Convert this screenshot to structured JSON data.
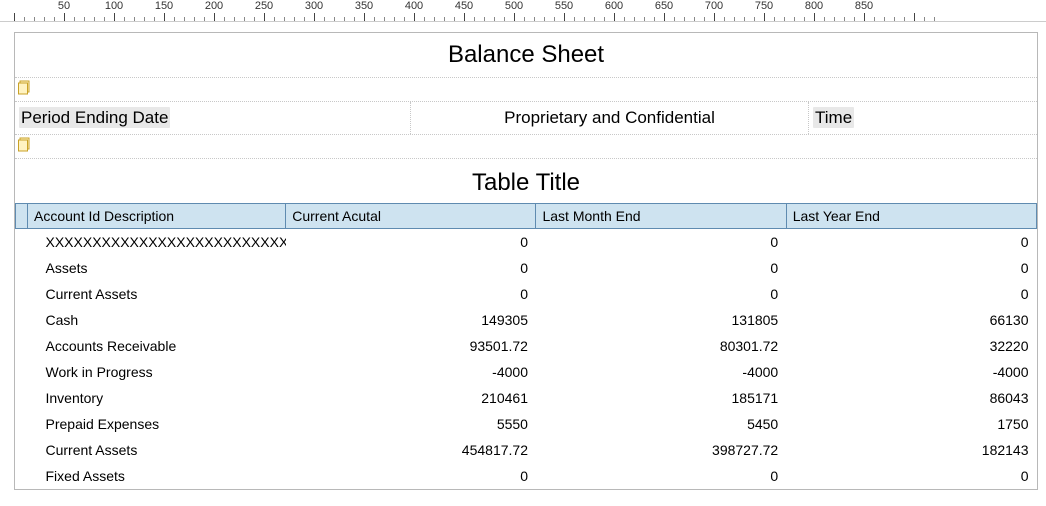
{
  "ruler": {
    "start": 50,
    "end": 870,
    "major": 50,
    "minor": 10
  },
  "report": {
    "title": "Balance Sheet",
    "header": {
      "period_label": "Period Ending Date",
      "confidential": "Proprietary and Confidential",
      "time_label": "Time"
    },
    "table_title": "Table Title",
    "columns": [
      "Account Id Description",
      "Current Acutal",
      "Last Month End",
      "Last Year End"
    ],
    "rows": [
      {
        "desc": "XXXXXXXXXXXXXXXXXXXXXXXXXXXXXXX",
        "c1": "0",
        "c2": "0",
        "c3": "0"
      },
      {
        "desc": "Assets",
        "c1": "0",
        "c2": "0",
        "c3": "0"
      },
      {
        "desc": "Current Assets",
        "c1": "0",
        "c2": "0",
        "c3": "0"
      },
      {
        "desc": "Cash",
        "c1": "149305",
        "c2": "131805",
        "c3": "66130"
      },
      {
        "desc": "Accounts Receivable",
        "c1": "93501.72",
        "c2": "80301.72",
        "c3": "32220"
      },
      {
        "desc": "Work in Progress",
        "c1": "-4000",
        "c2": "-4000",
        "c3": "-4000"
      },
      {
        "desc": "Inventory",
        "c1": "210461",
        "c2": "185171",
        "c3": "86043"
      },
      {
        "desc": "Prepaid Expenses",
        "c1": "5550",
        "c2": "5450",
        "c3": "1750"
      },
      {
        "desc": "Current Assets",
        "c1": "454817.72",
        "c2": "398727.72",
        "c3": "182143"
      },
      {
        "desc": "Fixed Assets",
        "c1": "0",
        "c2": "0",
        "c3": "0"
      }
    ]
  },
  "chart_data": {
    "type": "table",
    "title": "Balance Sheet",
    "columns": [
      "Account Id Description",
      "Current Acutal",
      "Last Month End",
      "Last Year End"
    ],
    "rows": [
      [
        "XXXXXXXXXXXXXXXXXXXXXXXXXXXXXXX",
        0,
        0,
        0
      ],
      [
        "Assets",
        0,
        0,
        0
      ],
      [
        "Current Assets",
        0,
        0,
        0
      ],
      [
        "Cash",
        149305,
        131805,
        66130
      ],
      [
        "Accounts Receivable",
        93501.72,
        80301.72,
        32220
      ],
      [
        "Work in Progress",
        -4000,
        -4000,
        -4000
      ],
      [
        "Inventory",
        210461,
        185171,
        86043
      ],
      [
        "Prepaid Expenses",
        5550,
        5450,
        1750
      ],
      [
        "Current Assets",
        454817.72,
        398727.72,
        182143
      ],
      [
        "Fixed Assets",
        0,
        0,
        0
      ]
    ]
  }
}
